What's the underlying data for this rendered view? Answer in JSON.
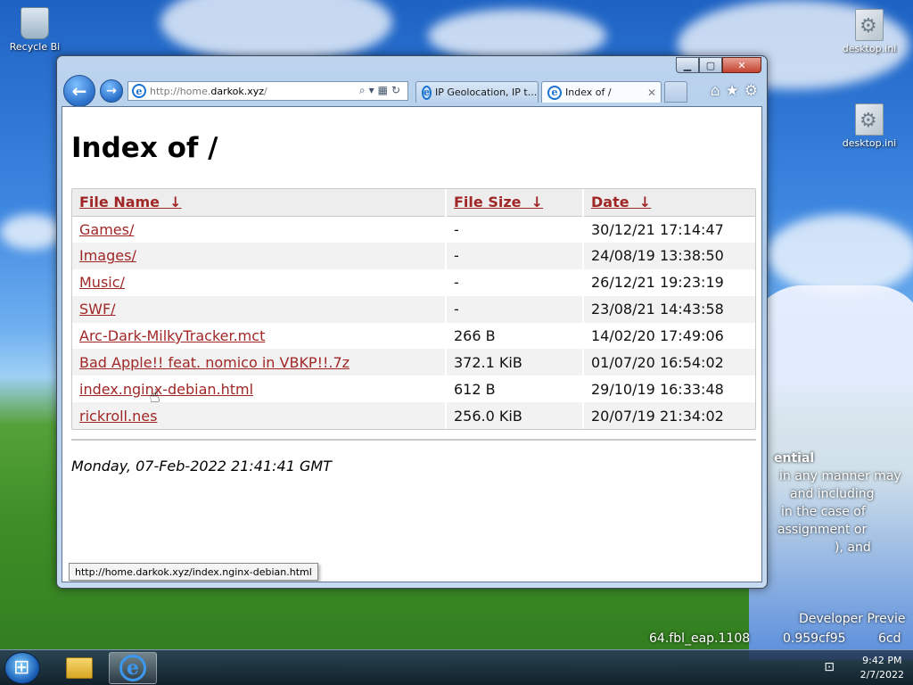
{
  "desktop": {
    "recycle_label": "Recycle Bi",
    "icon1_label": "desktop.ini",
    "icon2_label": "desktop.ini",
    "bg_lines": [
      "ential",
      "in any manner may",
      "and including",
      "in the case of",
      "assignment or",
      "), and",
      "Developer Previe",
      "64.fbl_eap.1108",
      "0.959cf95",
      "6cd"
    ]
  },
  "browser": {
    "address_prefix": "http://home.",
    "address_domain": "darkok.xyz",
    "address_suffix": "/",
    "tabs": [
      {
        "label": "IP Geolocation, IP t..."
      },
      {
        "label": "Index of /"
      }
    ],
    "status_url": "http://home.darkok.xyz/index.nginx-debian.html"
  },
  "page": {
    "title": "Index of /",
    "columns": [
      {
        "label": "File Name",
        "sort": "↓"
      },
      {
        "label": "File Size",
        "sort": "↓"
      },
      {
        "label": "Date",
        "sort": "↓"
      }
    ],
    "rows": [
      {
        "name": "Games/",
        "size": "-",
        "date": "30/12/21 17:14:47"
      },
      {
        "name": "Images/",
        "size": "-",
        "date": "24/08/19 13:38:50"
      },
      {
        "name": "Music/",
        "size": "-",
        "date": "26/12/21 19:23:19"
      },
      {
        "name": "SWF/",
        "size": "-",
        "date": "23/08/21 14:43:58"
      },
      {
        "name": "Arc-Dark-MilkyTracker.mct",
        "size": "266 B",
        "date": "14/02/20 17:49:06"
      },
      {
        "name": "Bad Apple!! feat. nomico in VBKP!!.7z",
        "size": "372.1 KiB",
        "date": "01/07/20 16:54:02"
      },
      {
        "name": "index.nginx-debian.html",
        "size": "612 B",
        "date": "29/10/19 16:33:48"
      },
      {
        "name": "rickroll.nes",
        "size": "256.0 KiB",
        "date": "20/07/19 21:34:02"
      }
    ],
    "footer": "Monday, 07-Feb-2022 21:41:41 GMT"
  },
  "taskbar": {
    "time": "9:42 PM",
    "date": "2/7/2022"
  }
}
